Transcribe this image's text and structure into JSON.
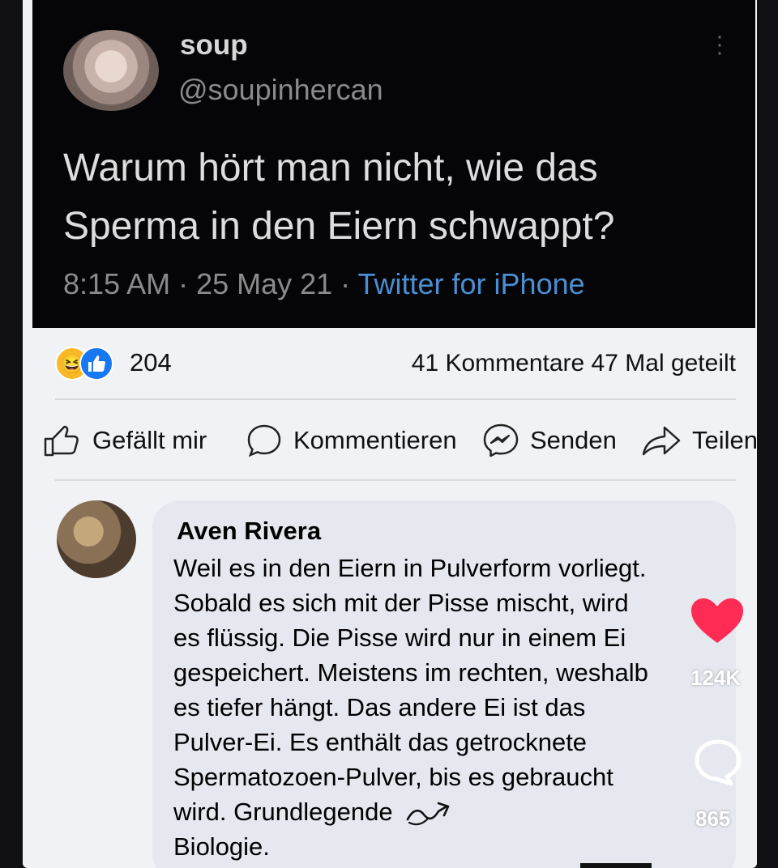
{
  "tweet": {
    "name": "soup",
    "handle": "@soupinhercan",
    "text_lines": [
      "Warum hört man nicht, wie das",
      "Sperma in den Eiern schwappt?"
    ],
    "time": "8:15 AM · 25 May 21 · ",
    "source": "Twitter for iPhone"
  },
  "post": {
    "reaction_count": "204",
    "comments_shares": "41 Kommentare  47 Mal geteilt",
    "actions": {
      "like": "Gefällt mir",
      "comment": "Kommentieren",
      "send": "Senden",
      "share": "Teilen"
    }
  },
  "comment": {
    "author": "Aven Rivera",
    "lines": [
      "Weil es in den Eiern in Pulverform vorliegt.",
      "Sobald es sich mit der Pisse mischt, wird",
      "es flüssig. Die Pisse wird nur in einem Ei",
      "gespeichert. Meistens im rechten, weshalb",
      "es tiefer hängt. Das andere Ei ist das",
      "Pulver-Ei. Es enthält das getrocknete",
      "Spermatozoen-Pulver, bis es gebraucht",
      "wird. Grundlegende",
      "Biologie."
    ]
  },
  "overlay": {
    "likes": "124K",
    "comments": "865",
    "heart_color": "#fe2c55"
  },
  "colors": {
    "twitter_source": "#4a8fd2",
    "facebook_like": "#1877f2",
    "haha": "#f7b928"
  }
}
